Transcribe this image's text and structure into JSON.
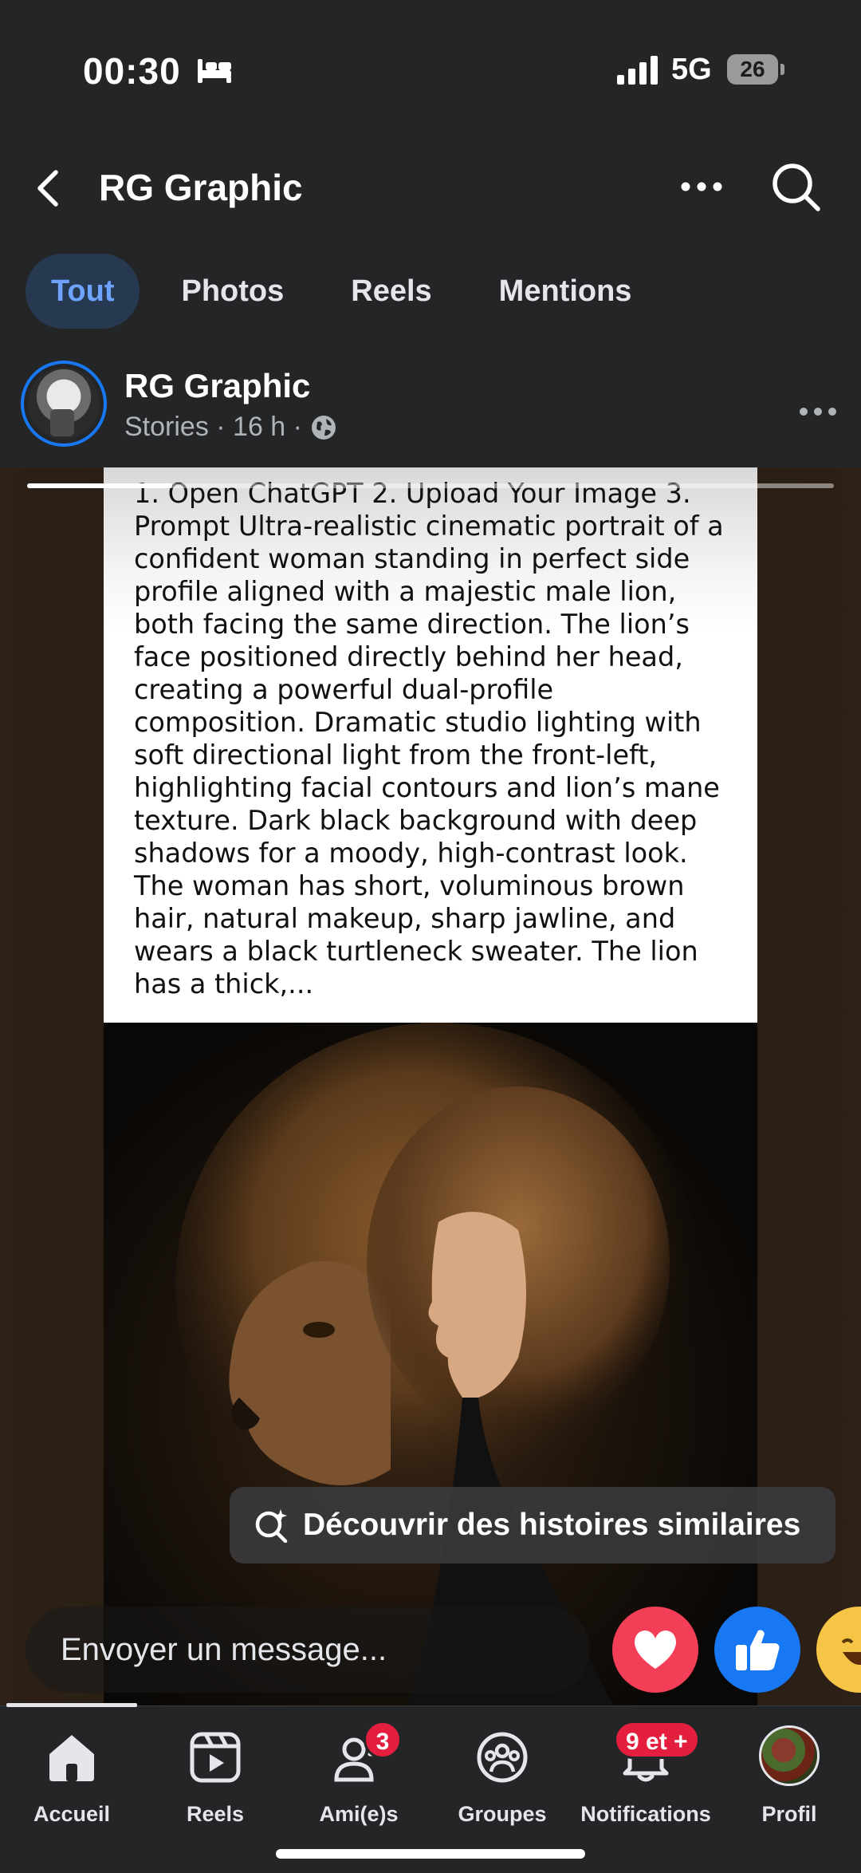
{
  "status_bar": {
    "time": "00:30",
    "network": "5G",
    "battery": "26"
  },
  "header": {
    "title": "RG Graphic"
  },
  "tabs": [
    {
      "label": "Tout",
      "active": true
    },
    {
      "label": "Photos",
      "active": false
    },
    {
      "label": "Reels",
      "active": false
    },
    {
      "label": "Mentions",
      "active": false
    }
  ],
  "post": {
    "author": "RG Graphic",
    "meta": "Stories · 16 h ·"
  },
  "story": {
    "progress": 0.18,
    "text": "1. Open ChatGPT 2. Upload Your Image 3. Prompt Ultra-realistic cinematic portrait of a confident woman standing in perfect side profile aligned with a majestic male lion, both facing the same direction. The lion’s face positioned directly behind her head, creating a powerful dual-profile composition. Dramatic studio lighting with soft directional light from the front-left, highlighting facial contours and lion’s mane texture. Dark black background with deep shadows for a moody, high-contrast look. The woman has short, voluminous brown hair, natural makeup, sharp jawline, and wears a black turtleneck sweater. The lion has a thick,...",
    "discover_label": "Découvrir des histoires similaires",
    "message_placeholder": "Envoyer un message..."
  },
  "bottom_nav": [
    {
      "label": "Accueil",
      "icon": "home-icon",
      "badge": ""
    },
    {
      "label": "Reels",
      "icon": "reels-icon",
      "badge": ""
    },
    {
      "label": "Ami(e)s",
      "icon": "friends-icon",
      "badge": "3"
    },
    {
      "label": "Groupes",
      "icon": "groups-icon",
      "badge": ""
    },
    {
      "label": "Notifications",
      "icon": "bell-icon",
      "badge": "9 et +"
    },
    {
      "label": "Profil",
      "icon": "profile-avatar",
      "badge": ""
    }
  ],
  "colors": {
    "background": "#242527",
    "accent": "#1877f2",
    "active_tab_bg": "#263951",
    "active_tab_text": "#6ea3ff",
    "badge": "#e41e3f",
    "love": "#f33e58",
    "haha": "#f7c545"
  }
}
